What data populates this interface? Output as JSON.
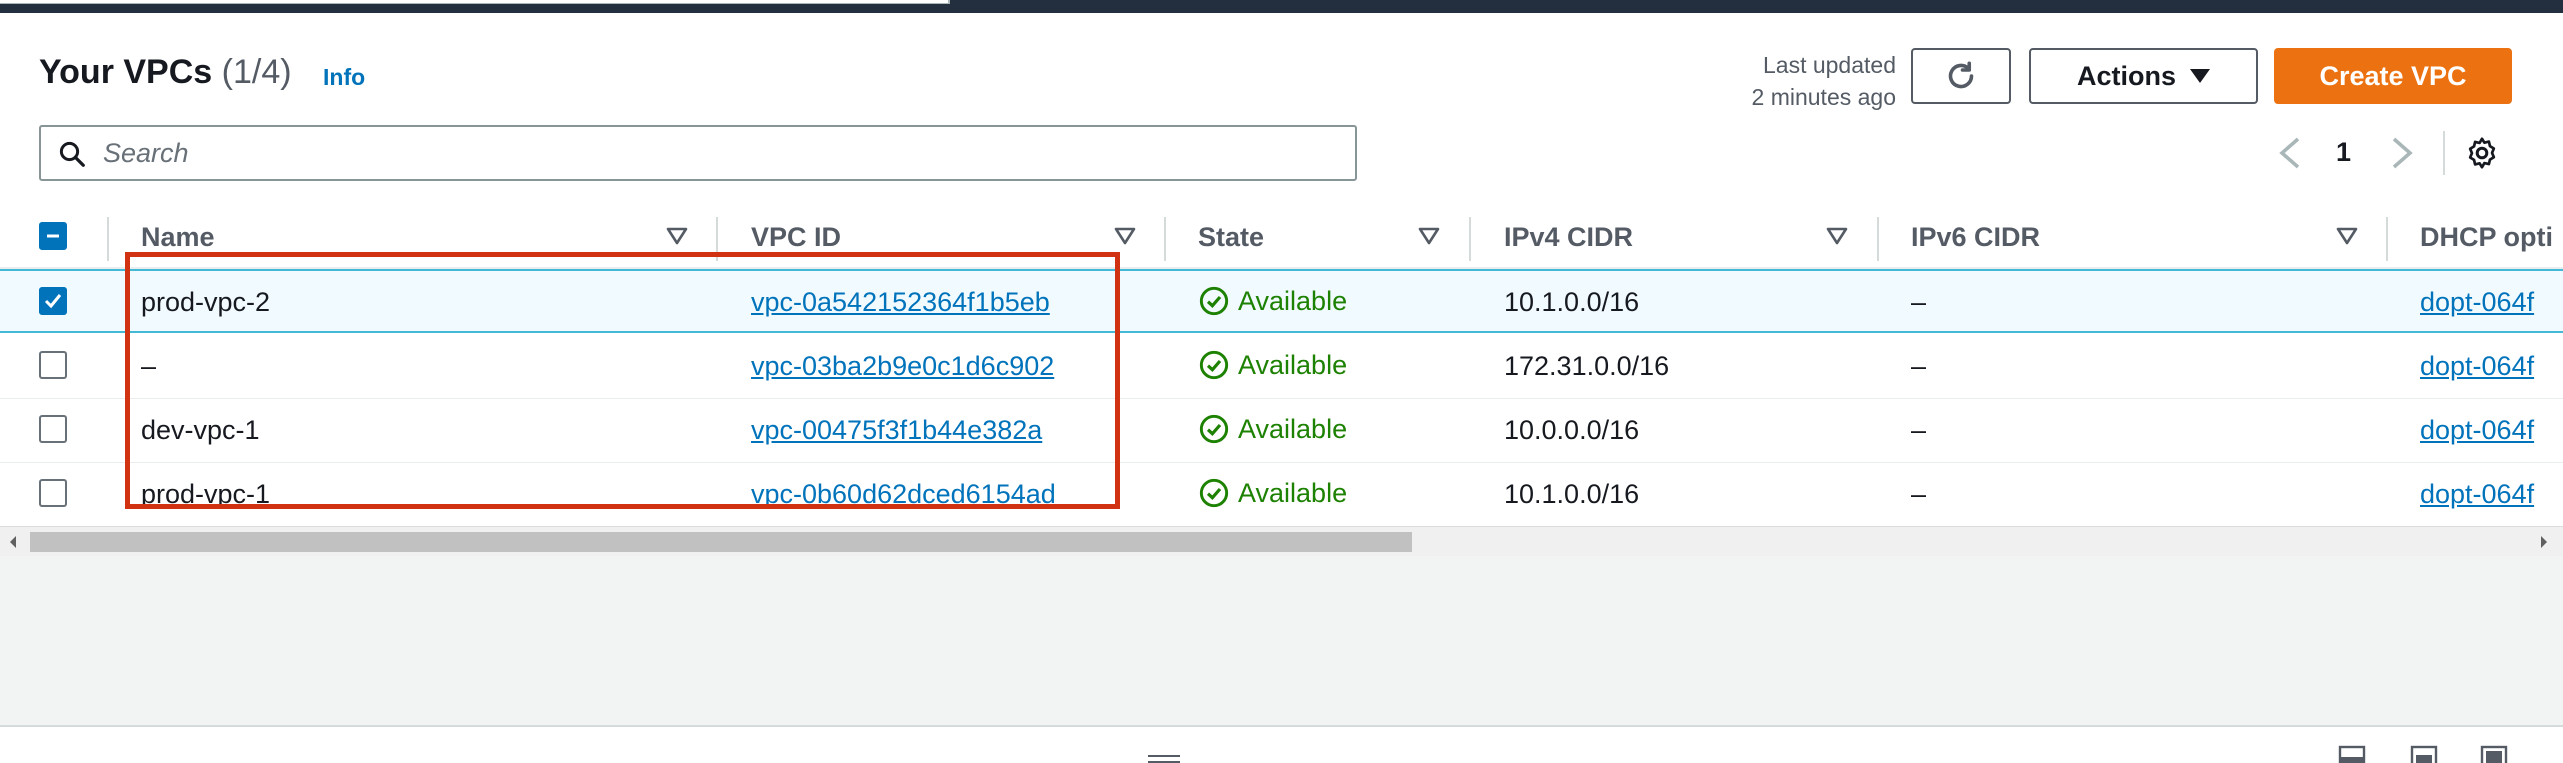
{
  "header": {
    "title": "Your VPCs",
    "count": "(1/4)",
    "info_label": "Info",
    "last_updated_line1": "Last updated",
    "last_updated_line2": "2 minutes ago"
  },
  "toolbar": {
    "refresh_icon": "refresh-icon",
    "actions_label": "Actions",
    "create_label": "Create VPC"
  },
  "search": {
    "placeholder": "Search",
    "value": ""
  },
  "pagination": {
    "current_page": "1"
  },
  "table": {
    "columns": [
      "Name",
      "VPC ID",
      "State",
      "IPv4 CIDR",
      "IPv6 CIDR",
      "DHCP opti"
    ],
    "rows": [
      {
        "selected": true,
        "name": "prod-vpc-2",
        "vpc_id": "vpc-0a542152364f1b5eb",
        "state": "Available",
        "ipv4": "10.1.0.0/16",
        "ipv6": "–",
        "dhcp": "dopt-064f"
      },
      {
        "selected": false,
        "name": "–",
        "vpc_id": "vpc-03ba2b9e0c1d6c902",
        "state": "Available",
        "ipv4": "172.31.0.0/16",
        "ipv6": "–",
        "dhcp": "dopt-064f"
      },
      {
        "selected": false,
        "name": "dev-vpc-1",
        "vpc_id": "vpc-00475f3f1b44e382a",
        "state": "Available",
        "ipv4": "10.0.0.0/16",
        "ipv6": "–",
        "dhcp": "dopt-064f"
      },
      {
        "selected": false,
        "name": "prod-vpc-1",
        "vpc_id": "vpc-0b60d62dced6154ad",
        "state": "Available",
        "ipv4": "10.1.0.0/16",
        "ipv6": "–",
        "dhcp": "dopt-064f"
      }
    ]
  },
  "colors": {
    "link": "#0073bb",
    "primary_button": "#ec7211",
    "available": "#1d8102",
    "highlight": "#d13212"
  }
}
